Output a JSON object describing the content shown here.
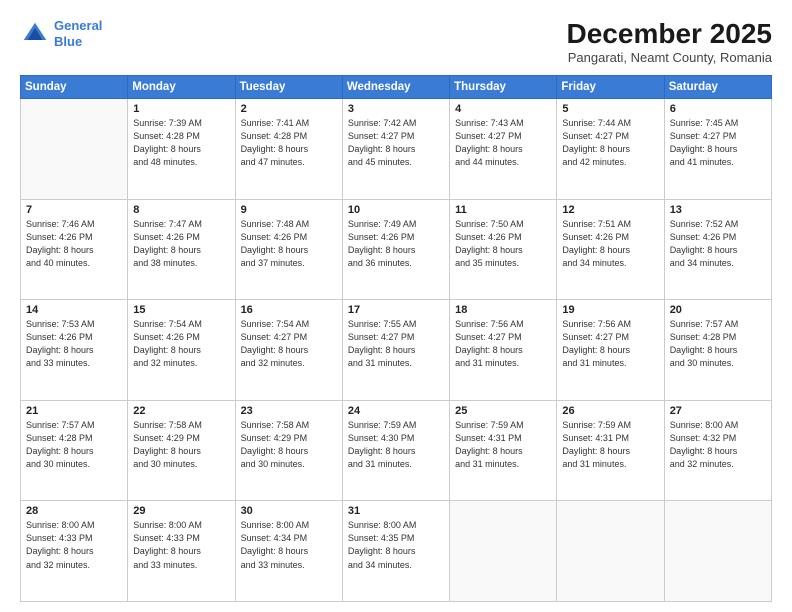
{
  "logo": {
    "line1": "General",
    "line2": "Blue"
  },
  "title": "December 2025",
  "subtitle": "Pangarati, Neamt County, Romania",
  "weekdays": [
    "Sunday",
    "Monday",
    "Tuesday",
    "Wednesday",
    "Thursday",
    "Friday",
    "Saturday"
  ],
  "weeks": [
    [
      {
        "day": "",
        "info": ""
      },
      {
        "day": "1",
        "info": "Sunrise: 7:39 AM\nSunset: 4:28 PM\nDaylight: 8 hours\nand 48 minutes."
      },
      {
        "day": "2",
        "info": "Sunrise: 7:41 AM\nSunset: 4:28 PM\nDaylight: 8 hours\nand 47 minutes."
      },
      {
        "day": "3",
        "info": "Sunrise: 7:42 AM\nSunset: 4:27 PM\nDaylight: 8 hours\nand 45 minutes."
      },
      {
        "day": "4",
        "info": "Sunrise: 7:43 AM\nSunset: 4:27 PM\nDaylight: 8 hours\nand 44 minutes."
      },
      {
        "day": "5",
        "info": "Sunrise: 7:44 AM\nSunset: 4:27 PM\nDaylight: 8 hours\nand 42 minutes."
      },
      {
        "day": "6",
        "info": "Sunrise: 7:45 AM\nSunset: 4:27 PM\nDaylight: 8 hours\nand 41 minutes."
      }
    ],
    [
      {
        "day": "7",
        "info": "Sunrise: 7:46 AM\nSunset: 4:26 PM\nDaylight: 8 hours\nand 40 minutes."
      },
      {
        "day": "8",
        "info": "Sunrise: 7:47 AM\nSunset: 4:26 PM\nDaylight: 8 hours\nand 38 minutes."
      },
      {
        "day": "9",
        "info": "Sunrise: 7:48 AM\nSunset: 4:26 PM\nDaylight: 8 hours\nand 37 minutes."
      },
      {
        "day": "10",
        "info": "Sunrise: 7:49 AM\nSunset: 4:26 PM\nDaylight: 8 hours\nand 36 minutes."
      },
      {
        "day": "11",
        "info": "Sunrise: 7:50 AM\nSunset: 4:26 PM\nDaylight: 8 hours\nand 35 minutes."
      },
      {
        "day": "12",
        "info": "Sunrise: 7:51 AM\nSunset: 4:26 PM\nDaylight: 8 hours\nand 34 minutes."
      },
      {
        "day": "13",
        "info": "Sunrise: 7:52 AM\nSunset: 4:26 PM\nDaylight: 8 hours\nand 34 minutes."
      }
    ],
    [
      {
        "day": "14",
        "info": "Sunrise: 7:53 AM\nSunset: 4:26 PM\nDaylight: 8 hours\nand 33 minutes."
      },
      {
        "day": "15",
        "info": "Sunrise: 7:54 AM\nSunset: 4:26 PM\nDaylight: 8 hours\nand 32 minutes."
      },
      {
        "day": "16",
        "info": "Sunrise: 7:54 AM\nSunset: 4:27 PM\nDaylight: 8 hours\nand 32 minutes."
      },
      {
        "day": "17",
        "info": "Sunrise: 7:55 AM\nSunset: 4:27 PM\nDaylight: 8 hours\nand 31 minutes."
      },
      {
        "day": "18",
        "info": "Sunrise: 7:56 AM\nSunset: 4:27 PM\nDaylight: 8 hours\nand 31 minutes."
      },
      {
        "day": "19",
        "info": "Sunrise: 7:56 AM\nSunset: 4:27 PM\nDaylight: 8 hours\nand 31 minutes."
      },
      {
        "day": "20",
        "info": "Sunrise: 7:57 AM\nSunset: 4:28 PM\nDaylight: 8 hours\nand 30 minutes."
      }
    ],
    [
      {
        "day": "21",
        "info": "Sunrise: 7:57 AM\nSunset: 4:28 PM\nDaylight: 8 hours\nand 30 minutes."
      },
      {
        "day": "22",
        "info": "Sunrise: 7:58 AM\nSunset: 4:29 PM\nDaylight: 8 hours\nand 30 minutes."
      },
      {
        "day": "23",
        "info": "Sunrise: 7:58 AM\nSunset: 4:29 PM\nDaylight: 8 hours\nand 30 minutes."
      },
      {
        "day": "24",
        "info": "Sunrise: 7:59 AM\nSunset: 4:30 PM\nDaylight: 8 hours\nand 31 minutes."
      },
      {
        "day": "25",
        "info": "Sunrise: 7:59 AM\nSunset: 4:31 PM\nDaylight: 8 hours\nand 31 minutes."
      },
      {
        "day": "26",
        "info": "Sunrise: 7:59 AM\nSunset: 4:31 PM\nDaylight: 8 hours\nand 31 minutes."
      },
      {
        "day": "27",
        "info": "Sunrise: 8:00 AM\nSunset: 4:32 PM\nDaylight: 8 hours\nand 32 minutes."
      }
    ],
    [
      {
        "day": "28",
        "info": "Sunrise: 8:00 AM\nSunset: 4:33 PM\nDaylight: 8 hours\nand 32 minutes."
      },
      {
        "day": "29",
        "info": "Sunrise: 8:00 AM\nSunset: 4:33 PM\nDaylight: 8 hours\nand 33 minutes."
      },
      {
        "day": "30",
        "info": "Sunrise: 8:00 AM\nSunset: 4:34 PM\nDaylight: 8 hours\nand 33 minutes."
      },
      {
        "day": "31",
        "info": "Sunrise: 8:00 AM\nSunset: 4:35 PM\nDaylight: 8 hours\nand 34 minutes."
      },
      {
        "day": "",
        "info": ""
      },
      {
        "day": "",
        "info": ""
      },
      {
        "day": "",
        "info": ""
      }
    ]
  ]
}
